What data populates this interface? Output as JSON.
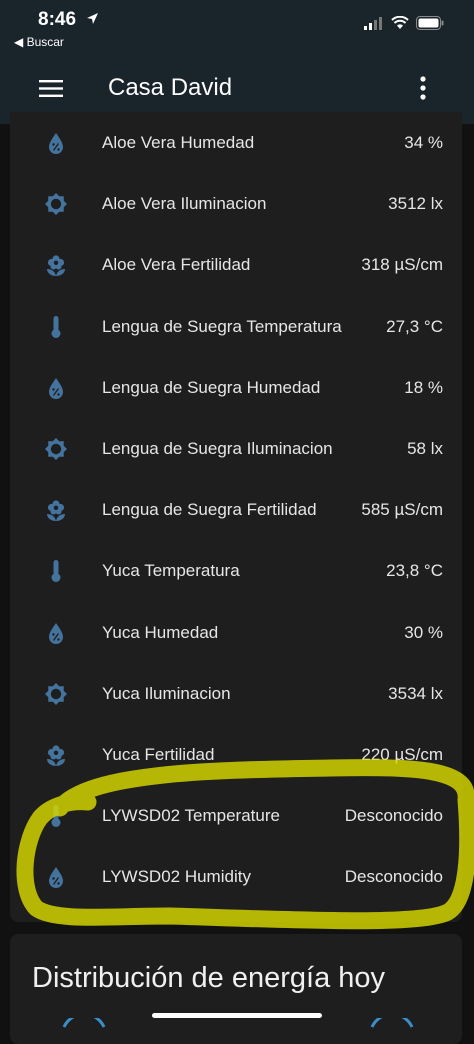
{
  "status_bar": {
    "time": "8:46",
    "back_label": "◀ Buscar"
  },
  "app_bar": {
    "title": "Casa David"
  },
  "entities": [
    {
      "icon": "water-percent-icon",
      "label": "Aloe Vera Humedad",
      "value": "34 %"
    },
    {
      "icon": "brightness-icon",
      "label": "Aloe Vera Iluminacion",
      "value": "3512 lx"
    },
    {
      "icon": "flower-icon",
      "label": "Aloe Vera Fertilidad",
      "value": "318 µS/cm"
    },
    {
      "icon": "thermometer-icon",
      "label": "Lengua de Suegra Temperatura",
      "value": "27,3 °C"
    },
    {
      "icon": "water-percent-icon",
      "label": "Lengua de Suegra Humedad",
      "value": "18 %"
    },
    {
      "icon": "brightness-icon",
      "label": "Lengua de Suegra Iluminacion",
      "value": "58 lx"
    },
    {
      "icon": "flower-icon",
      "label": "Lengua de Suegra Fertilidad",
      "value": "585 µS/cm"
    },
    {
      "icon": "thermometer-icon",
      "label": "Yuca Temperatura",
      "value": "23,8 °C"
    },
    {
      "icon": "water-percent-icon",
      "label": "Yuca Humedad",
      "value": "30 %"
    },
    {
      "icon": "brightness-icon",
      "label": "Yuca Iluminacion",
      "value": "3534 lx"
    },
    {
      "icon": "flower-icon",
      "label": "Yuca Fertilidad",
      "value": "220 µS/cm"
    },
    {
      "icon": "thermometer-icon",
      "label": "LYWSD02 Temperature",
      "value": "Desconocido"
    },
    {
      "icon": "water-percent-icon",
      "label": "LYWSD02 Humidity",
      "value": "Desconocido"
    }
  ],
  "energy_card": {
    "title": "Distribución de energía hoy"
  },
  "colors": {
    "icon": "#44739e",
    "highlight": "#e2e000",
    "app_bar": "#1a242b"
  }
}
